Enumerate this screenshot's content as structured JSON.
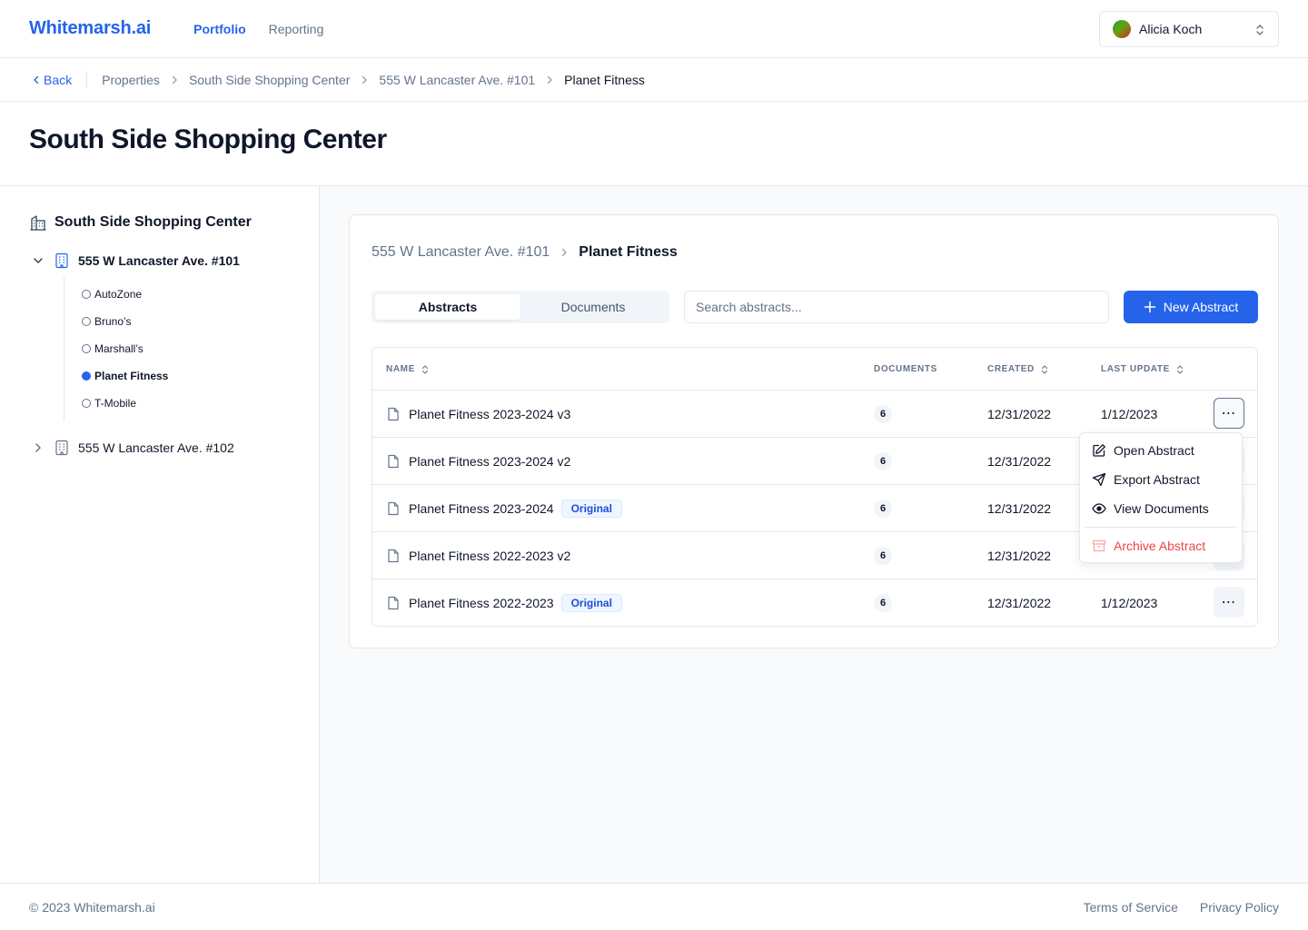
{
  "brand": "Whitemarsh.ai",
  "nav": {
    "portfolio": "Portfolio",
    "reporting": "Reporting"
  },
  "user": {
    "name": "Alicia Koch"
  },
  "breadcrumb": {
    "back": "Back",
    "items": [
      "Properties",
      "South Side Shopping Center",
      "555 W Lancaster Ave. #101",
      "Planet Fitness"
    ]
  },
  "page_title": "South Side Shopping Center",
  "sidebar": {
    "title": "South Side Shopping Center",
    "units": [
      {
        "label": "555 W Lancaster Ave. #101",
        "expanded": true,
        "tenants": [
          "AutoZone",
          "Bruno’s",
          "Marshall’s",
          "Planet Fitness",
          "T-Mobile"
        ],
        "active_tenant": "Planet Fitness"
      },
      {
        "label": "555 W Lancaster Ave. #102",
        "expanded": false
      }
    ]
  },
  "card": {
    "crumb_unit": "555 W Lancaster Ave. #101",
    "crumb_tenant": "Planet Fitness",
    "tabs": [
      "Abstracts",
      "Documents"
    ],
    "active_tab": "Abstracts",
    "search_placeholder": "Search abstracts...",
    "new_button": "New Abstract"
  },
  "table": {
    "columns": {
      "name": "NAME",
      "documents": "DOCUMENTS",
      "created": "CREATED",
      "last_update": "LAST UPDATE"
    },
    "rows": [
      {
        "name": "Planet Fitness 2023-2024 v3",
        "badge": "",
        "documents": "6",
        "created": "12/31/2022",
        "last_update": "1/12/2023"
      },
      {
        "name": "Planet Fitness 2023-2024 v2",
        "badge": "",
        "documents": "6",
        "created": "12/31/2022",
        "last_update": ""
      },
      {
        "name": "Planet Fitness 2023-2024",
        "badge": "Original",
        "documents": "6",
        "created": "12/31/2022",
        "last_update": ""
      },
      {
        "name": "Planet Fitness 2022-2023 v2",
        "badge": "",
        "documents": "6",
        "created": "12/31/2022",
        "last_update": ""
      },
      {
        "name": "Planet Fitness 2022-2023",
        "badge": "Original",
        "documents": "6",
        "created": "12/31/2022",
        "last_update": "1/12/2023"
      }
    ]
  },
  "row_menu": {
    "open": "Open Abstract",
    "export": "Export Abstract",
    "view": "View Documents",
    "archive": "Archive Abstract"
  },
  "footer": {
    "copyright": "© 2023 Whitemarsh.ai",
    "terms": "Terms of Service",
    "privacy": "Privacy Policy"
  },
  "colors": {
    "accent": "#2563eb",
    "danger": "#ef4444",
    "muted": "#64748b"
  }
}
